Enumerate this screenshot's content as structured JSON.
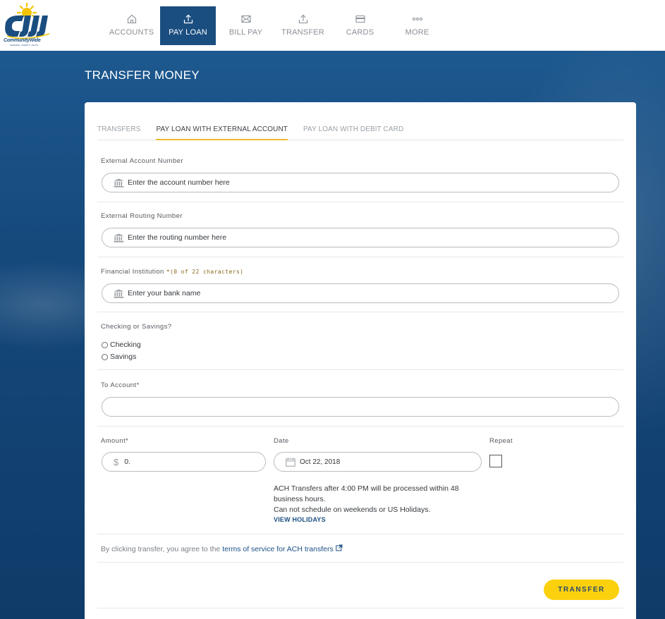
{
  "brand": {
    "name": "CommunityWide",
    "tagline": "FEDERAL CREDIT UNION",
    "colors": {
      "navy": "#1b4e80",
      "accent": "#f2b830",
      "button": "#fbd10e"
    }
  },
  "nav": {
    "items": [
      {
        "label": "ACCOUNTS",
        "icon": "home-icon"
      },
      {
        "label": "PAY LOAN",
        "icon": "upload-icon",
        "active": true
      },
      {
        "label": "BILL PAY",
        "icon": "envelope-icon"
      },
      {
        "label": "TRANSFER",
        "icon": "share-icon"
      },
      {
        "label": "CARDS",
        "icon": "card-icon"
      },
      {
        "label": "MORE",
        "icon": "more-dots-icon"
      }
    ]
  },
  "page": {
    "title": "TRANSFER MONEY"
  },
  "tabs": [
    {
      "label": "TRANSFERS"
    },
    {
      "label": "PAY LOAN WITH EXTERNAL ACCOUNT",
      "active": true
    },
    {
      "label": "PAY LOAN WITH DEBIT CARD"
    }
  ],
  "form": {
    "external_account": {
      "label": "External Account Number",
      "placeholder": "Enter the account number here",
      "icon": "bank-icon"
    },
    "routing": {
      "label": "External Routing Number",
      "placeholder": "Enter the routing number here",
      "icon": "bank-icon"
    },
    "institution": {
      "label": "Financial Institution",
      "required_mark": "*",
      "hint": "(0 of 22 characters)",
      "placeholder": "Enter your bank name",
      "icon": "bank-icon"
    },
    "account_type": {
      "label": "Checking or Savings?",
      "options": [
        "Checking",
        "Savings"
      ]
    },
    "to_account": {
      "label": "To Account*",
      "value": ""
    },
    "amount": {
      "label": "Amount*",
      "currency": "$",
      "value": "0."
    },
    "date": {
      "label": "Date",
      "value": "Oct 22, 2018",
      "icon": "calendar-icon"
    },
    "repeat": {
      "label": "Repeat",
      "checked": false
    },
    "ach_note": {
      "line1": "ACH Transfers after 4:00 PM will be processed within 48 business hours.",
      "line2": "Can not schedule on weekends or US Holidays."
    },
    "view_holidays": "VIEW HOLIDAYS",
    "terms": {
      "prefix": "By clicking transfer, you agree to the",
      "link": "terms of service for ACH transfers",
      "icon": "external-link-icon"
    },
    "submit_label": "TRANSFER"
  }
}
